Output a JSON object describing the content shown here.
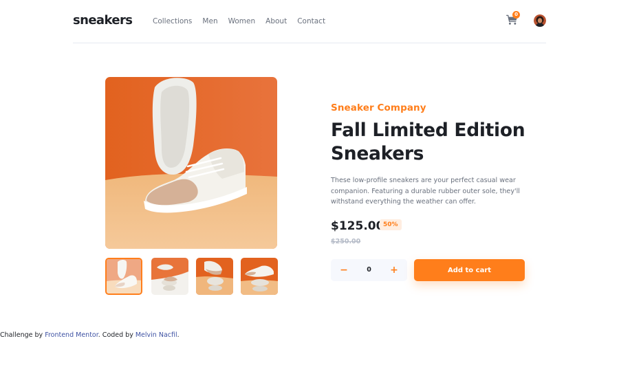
{
  "header": {
    "logo": "sneakers",
    "nav": [
      "Collections",
      "Men",
      "Women",
      "About",
      "Contact"
    ],
    "cart_count": "0",
    "cart_icon": "cart-icon",
    "avatar_icon": "user-avatar"
  },
  "product": {
    "company": "Sneaker Company",
    "title": "Fall Limited Edition Sneakers",
    "description": "These low-profile sneakers are your perfect casual wear companion. Featuring a durable rubber outer sole, they'll withstand everything the weather can offer.",
    "price": "$125.00",
    "discount": "50%",
    "original_price": "$250.00"
  },
  "cart_controls": {
    "minus": "−",
    "quantity": "0",
    "plus": "+",
    "add_label": "Add to cart"
  },
  "footer": {
    "prefix": "Challenge by ",
    "link1": "Frontend Mentor",
    "middle": ". Coded by ",
    "link2": "Melvin Nacfil",
    "suffix": "."
  },
  "colors": {
    "accent": "#ff7e1b",
    "pale_accent": "#ffede0",
    "dark": "#1d2026",
    "grey": "#69707d"
  }
}
